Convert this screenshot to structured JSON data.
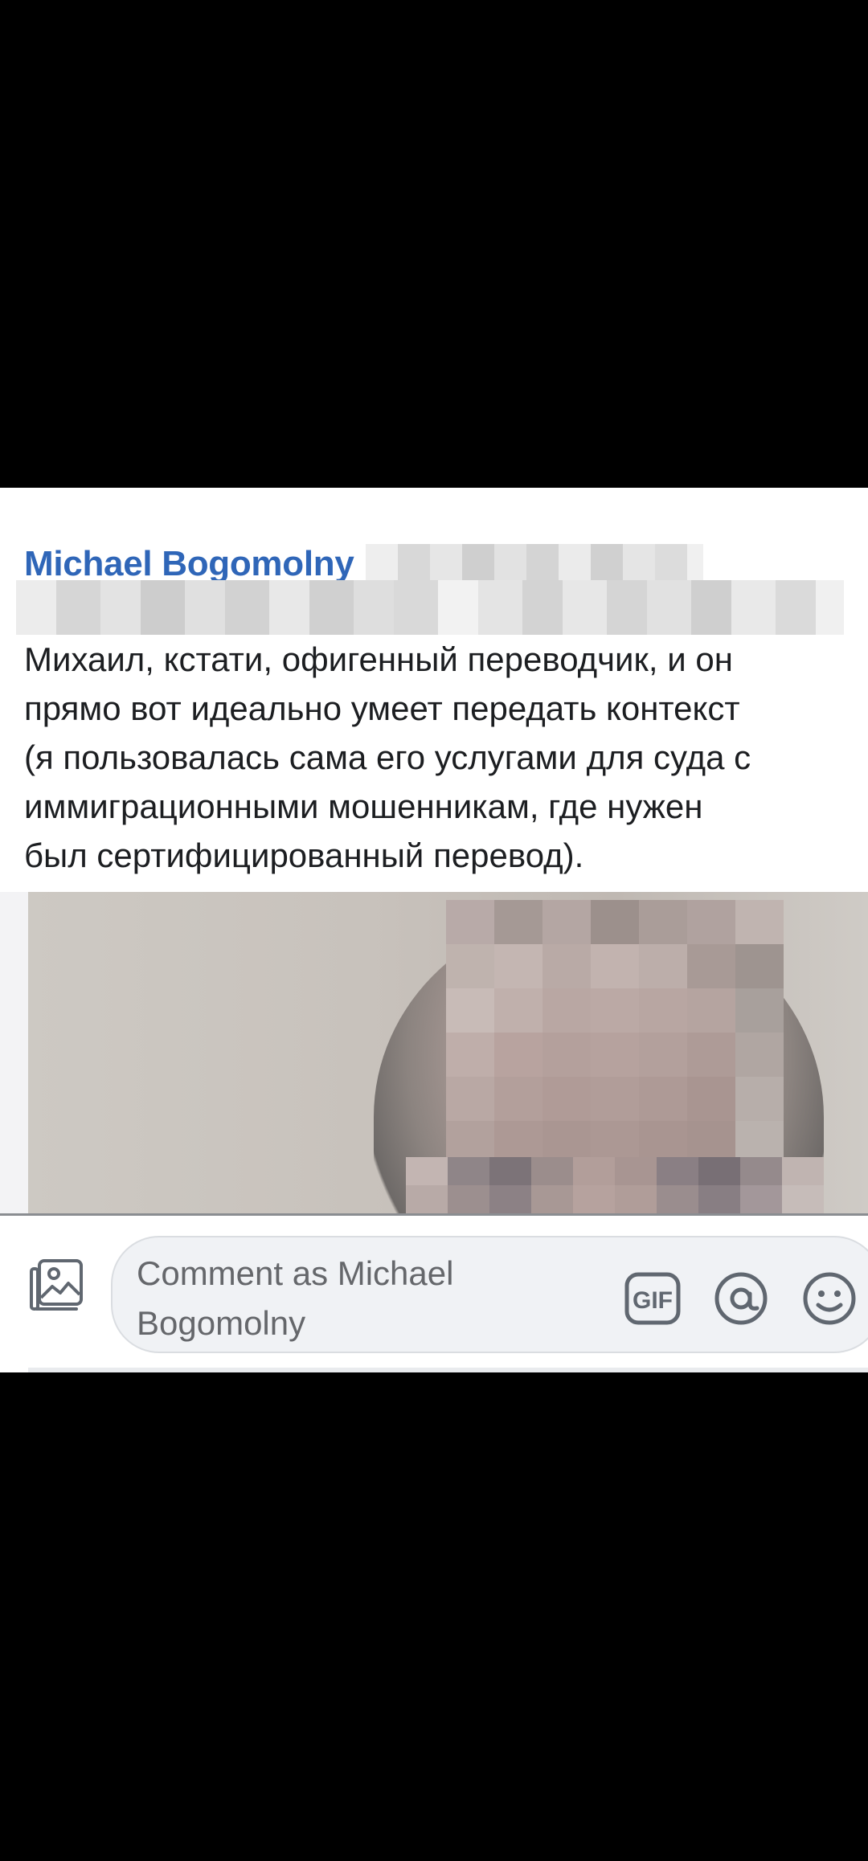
{
  "comment": {
    "author": "Michael Bogomolny",
    "text": "Михаил, кстати, офигенный переводчик, и он\nпрямо вот идеально умеет передать контекст\n(я пользовалась сама его услугами для суда с\nиммиграционными мошенникам, где нужен\nбыл сертифицированный перевод)."
  },
  "composer": {
    "placeholder": "Comment as Michael Bogomolny",
    "icons": [
      "photo-icon",
      "gif-icon",
      "mention-icon",
      "emoji-icon"
    ]
  },
  "colors": {
    "author_link": "#2f66b8",
    "text": "#1c1e21",
    "placeholder": "#65676b",
    "field_bg": "#f0f2f5"
  }
}
